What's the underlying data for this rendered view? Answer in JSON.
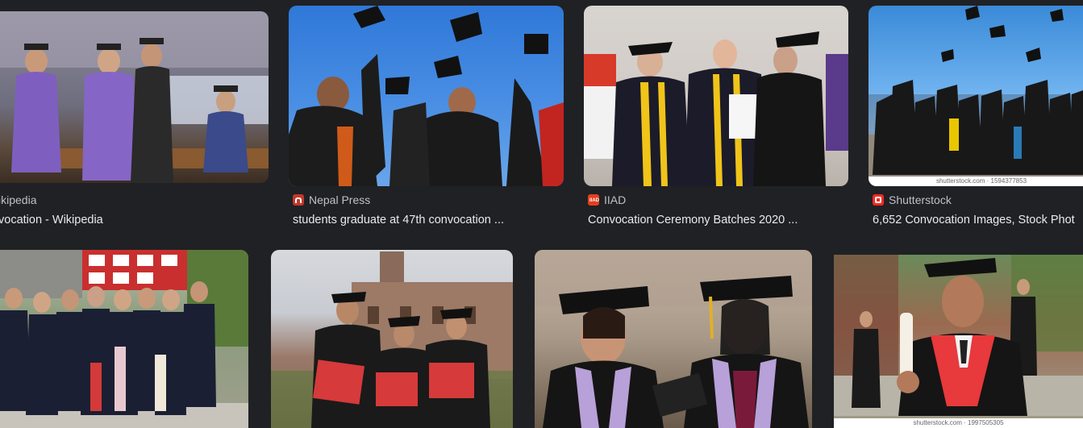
{
  "results": [
    {
      "source": "Wikipedia",
      "source_visible": "ikipedia",
      "favicon": "wikipedia-icon",
      "title": "Convocation - Wikipedia",
      "title_visible": "vocation - Wikipedia"
    },
    {
      "source": "Nepal Press",
      "favicon": "nepal-press-icon",
      "title": "students graduate at 47th convocation ..."
    },
    {
      "source": "IIAD",
      "favicon": "iiad-icon",
      "title": "Convocation Ceremony Batches 2020 ..."
    },
    {
      "source": "Shutterstock",
      "favicon": "shutterstock-icon",
      "title": "6,652 Convocation Images, Stock Phot",
      "watermark": "shutterstock.com · 1594377853"
    },
    {
      "image": "group-of-graduates-photo"
    },
    {
      "image": "three-graduates-with-certificates-photo"
    },
    {
      "image": "two-women-graduates-photo"
    },
    {
      "image": "graduate-holding-diploma-photo",
      "watermark": "shutterstock.com · 1997505305"
    }
  ],
  "colors": {
    "background": "#202124",
    "source_text": "#bdc1c6",
    "title_text": "#e8eaed",
    "nepal_press": "#c0392b",
    "iiad": "#e0401f",
    "shutterstock": "#ee2b24"
  }
}
